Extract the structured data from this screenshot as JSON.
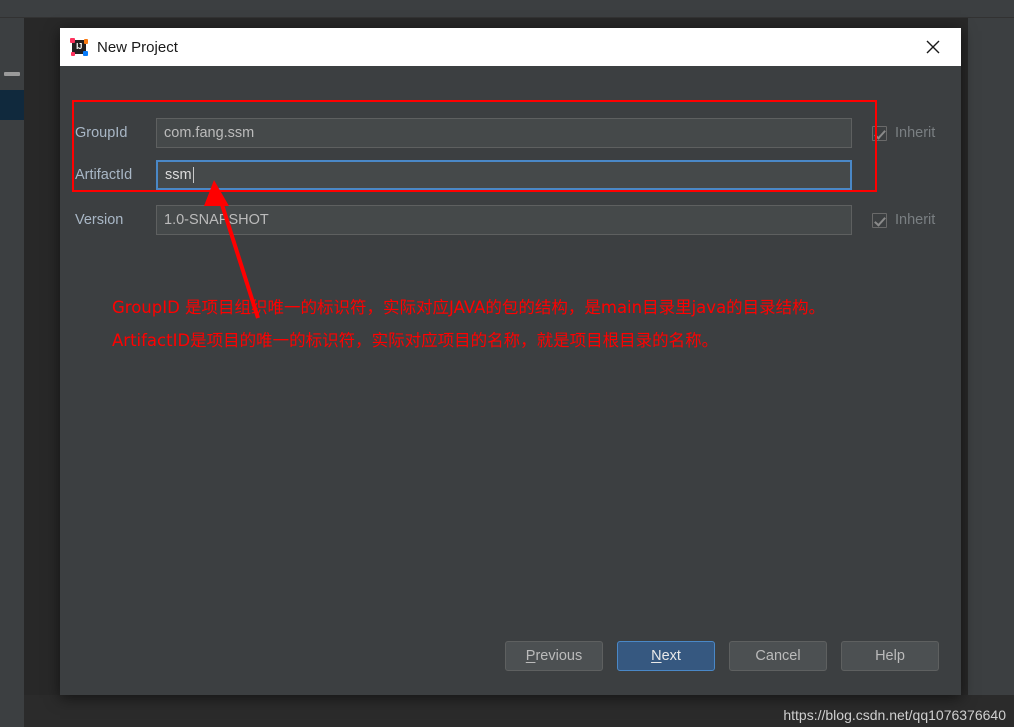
{
  "window": {
    "title": "New Project",
    "app_icon": "intellij-idea-icon",
    "close_icon": "close-icon"
  },
  "form": {
    "fields": [
      {
        "label": "GroupId",
        "value": "com.fang.ssm",
        "focused": false,
        "inherit_label": "Inherit",
        "inherit_checked": true
      },
      {
        "label": "ArtifactId",
        "value": "ssm",
        "focused": true,
        "inherit_label": "",
        "inherit_checked": false
      },
      {
        "label": "Version",
        "value": "1.0-SNAPSHOT",
        "focused": false,
        "inherit_label": "Inherit",
        "inherit_checked": true
      }
    ]
  },
  "annotations": {
    "box_color": "#ff0000",
    "arrow_color": "#ff0000",
    "text_color": "#ff0000",
    "line1": "GroupID 是项目组织唯一的标识符，实际对应JAVA的包的结构，是main目录里java的目录结构。",
    "line2": "ArtifactID是项目的唯一的标识符，实际对应项目的名称，就是项目根目录的名称。"
  },
  "footer": {
    "buttons": [
      {
        "label": "Previous",
        "mnemonic": "P",
        "primary": false
      },
      {
        "label": "Next",
        "mnemonic": "N",
        "primary": true
      },
      {
        "label": "Cancel",
        "mnemonic": "",
        "primary": false
      },
      {
        "label": "Help",
        "mnemonic": "",
        "primary": false
      }
    ]
  },
  "watermark": {
    "text": "https://blog.csdn.net/qq1076376640"
  },
  "colors": {
    "dialog_bg": "#3c3f41",
    "input_bg": "#45494a",
    "accent_blue": "#4a88c7",
    "primary_button": "#365880",
    "text": "#a9b7c6",
    "annotation_red": "#ff0000"
  }
}
